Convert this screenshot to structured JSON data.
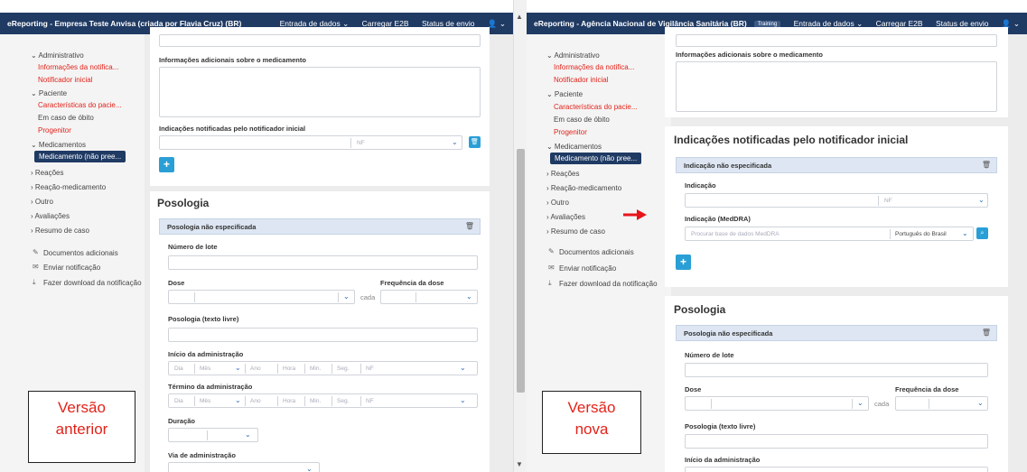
{
  "left": {
    "title": "eReporting - Empresa Teste Anvisa (criada por Flavia Cruz) (BR)",
    "nav": [
      "Entrada de dados ⌄",
      "Carregar E2B",
      "Status de envio",
      "👤 ⌄"
    ],
    "sidebar": {
      "administrativo": "⌄ Administrativo",
      "info_notificacao": "Informações da notifica...",
      "notificador_inicial": "Notificador inicial",
      "paciente": "⌄ Paciente",
      "caracteristicas": "Características do pacie...",
      "caso_obito": "Em caso de óbito",
      "progenitor": "Progenitor",
      "medicamentos": "⌄ Medicamentos",
      "medicamento_ativo": "Medicamento (não pree...",
      "reacoes": "› Reações",
      "reacao_medicamento": "› Reação-medicamento",
      "outro": "› Outro",
      "avaliacoes": "› Avaliações",
      "resumo": "› Resumo de caso",
      "documentos": "Documentos adicionais",
      "enviar": "Enviar notificação",
      "download": "Fazer download da notificação"
    },
    "form": {
      "info_adicionais": "Informações adicionais sobre o medicamento",
      "indicacoes": "Indicações notificadas pelo notificador inicial",
      "nf": "NF",
      "posologia_title": "Posologia",
      "posologia_strip": "Posologia não especificada",
      "numero_lote": "Número de lote",
      "dose": "Dose",
      "frequencia": "Frequência da dose",
      "cada": "cada",
      "posologia_livre": "Posologia (texto livre)",
      "inicio": "Início da administração",
      "termino": "Término da administração",
      "duracao": "Duração",
      "via": "Via de administração",
      "date_parts": [
        "Dia",
        "Mês",
        "Ano",
        "Hora",
        "Min.",
        "Seg.",
        "NF"
      ]
    },
    "caption": [
      "Versão",
      "anterior"
    ]
  },
  "right": {
    "title": "eReporting - Agência Nacional de Vigilância Sanitária (BR)",
    "badge": "Training",
    "nav": [
      "Entrada de dados ⌄",
      "Carregar E2B",
      "Status de envio",
      "👤 ⌄"
    ],
    "sidebar": {
      "administrativo": "⌄ Administrativo",
      "info_notificacao": "Informações da notifica...",
      "notificador_inicial": "Notificador inicial",
      "paciente": "⌄ Paciente",
      "caracteristicas": "Características do pacie...",
      "caso_obito": "Em caso de óbito",
      "progenitor": "Progenitor",
      "medicamentos": "⌄ Medicamentos",
      "medicamento_ativo": "Medicamento (não pree...",
      "reacoes": "› Reações",
      "reacao_medicamento": "› Reação-medicamento",
      "outro": "› Outro",
      "avaliacoes": "› Avaliações",
      "resumo": "› Resumo de caso",
      "documentos": "Documentos adicionais",
      "enviar": "Enviar notificação",
      "download": "Fazer download da notificação"
    },
    "form": {
      "info_adicionais": "Informações adicionais sobre o medicamento",
      "indicacoes_title": "Indicações notificadas pelo notificador inicial",
      "indicacao_strip": "Indicação não especificada",
      "indicacao": "Indicação",
      "nf": "NF",
      "indicacao_meddra": "Indicação (MedDRA)",
      "meddra_placeholder": "Procurar base de dados MedDRA",
      "idioma": "Português do Brasil",
      "posologia_title": "Posologia",
      "posologia_strip": "Posologia não especificada",
      "numero_lote": "Número de lote",
      "dose": "Dose",
      "frequencia": "Frequência da dose",
      "cada": "cada",
      "posologia_livre": "Posologia (texto livre)",
      "inicio": "Início da administração"
    },
    "caption": [
      "Versão",
      "nova"
    ]
  },
  "colors": {
    "topbar": "#1f3a63",
    "accent": "#2a9fd6",
    "link_red": "#e2231a",
    "arrow": "#e8141b"
  }
}
